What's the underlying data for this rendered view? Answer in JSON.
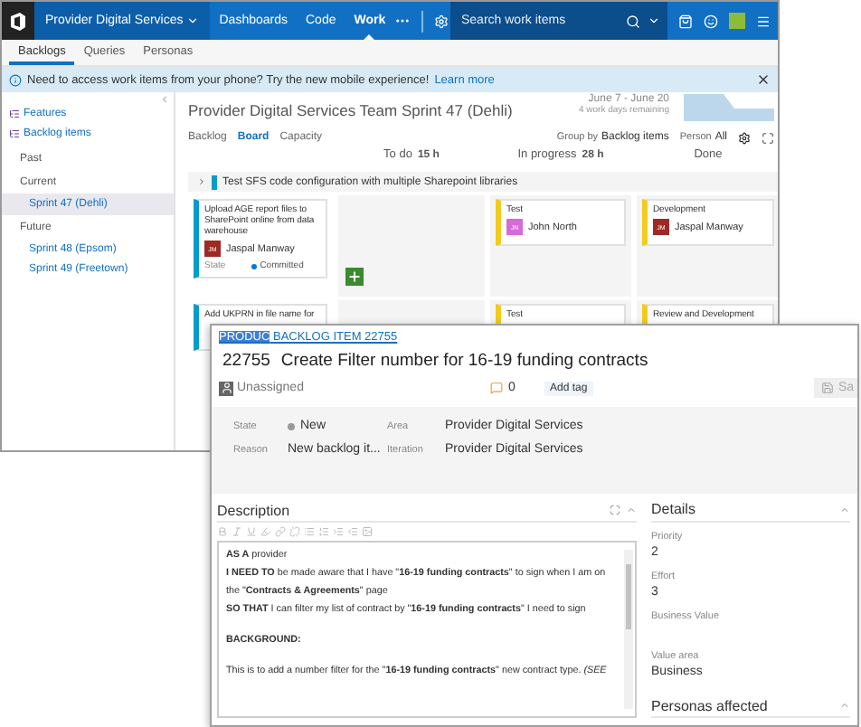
{
  "top_nav": {
    "project": "Provider Digital Services",
    "items": [
      {
        "label": "Dashboards",
        "selected": false
      },
      {
        "label": "Code",
        "selected": false
      },
      {
        "label": "Work",
        "selected": true
      }
    ],
    "search": {
      "placeholder": "Search work items"
    }
  },
  "sub_nav": [
    {
      "label": "Backlogs",
      "selected": true
    },
    {
      "label": "Queries",
      "selected": false
    },
    {
      "label": "Personas",
      "selected": false
    }
  ],
  "banner": {
    "text": "Need to access work items from your phone? Try the new mobile experience!",
    "link": "Learn more"
  },
  "sidebar": [
    {
      "label": "Features",
      "kind": "backlog",
      "selected": false
    },
    {
      "label": "Backlog items",
      "kind": "backlog",
      "selected": false
    },
    {
      "label": "Past",
      "kind": "heading",
      "selected": false
    },
    {
      "label": "Current",
      "kind": "heading",
      "selected": false
    },
    {
      "label": "Sprint 47 (Dehli)",
      "kind": "sprint",
      "selected": true
    },
    {
      "label": "Future",
      "kind": "heading",
      "selected": false
    },
    {
      "label": "Sprint 48 (Epsom)",
      "kind": "sprint",
      "selected": false
    },
    {
      "label": "Sprint 49 (Freetown)",
      "kind": "sprint",
      "selected": false
    }
  ],
  "sprint": {
    "title": "Provider Digital Services Team Sprint 47 (Dehli)",
    "dates": "June 7 - June 20",
    "remaining": "4 work days remaining",
    "views": [
      {
        "label": "Backlog",
        "selected": false
      },
      {
        "label": "Board",
        "selected": true
      },
      {
        "label": "Capacity",
        "selected": false
      }
    ],
    "group_by_label": "Group by",
    "group_by": "Backlog items",
    "person_label": "Person",
    "person": "All"
  },
  "board": {
    "columns": [
      {
        "name": "To do",
        "hours": "15 h"
      },
      {
        "name": "In progress",
        "hours": "28 h"
      },
      {
        "name": "Done"
      }
    ],
    "swimlane": "Test SFS code configuration with multiple Sharepoint libraries",
    "rows": [
      {
        "item": {
          "title": "Upload AGE report files to SharePoint online from data warehouse",
          "initials": "JM",
          "assignee": "Jaspal Manway",
          "state_label": "State",
          "state": "Committed"
        },
        "cells": [
          {
            "can_add": true
          },
          {
            "can_add": false,
            "tasks": [
              {
                "title": "Test",
                "initials": "JN",
                "assignee": "John North",
                "color": "#d66ad8"
              }
            ]
          },
          {
            "can_add": false,
            "tasks": [
              {
                "title": "Development",
                "initials": "JM",
                "assignee": "Jaspal Manway",
                "color": "#9e2a24"
              }
            ]
          }
        ]
      },
      {
        "item": {
          "title": "Add UKPRN in file name for"
        },
        "cells": [
          {},
          {
            "tasks": [
              {
                "title": "Test"
              }
            ]
          },
          {
            "tasks": [
              {
                "title": "Review and Development"
              }
            ]
          }
        ]
      }
    ]
  },
  "work_item": {
    "type_link": {
      "selected_part": "PRODUC",
      "rest": "BACKLOG ITEM 22755"
    },
    "id": "22755",
    "title": "Create Filter number for 16-19 funding contracts",
    "assignee": "Unassigned",
    "comments": "0",
    "add_tag": "Add tag",
    "save": "Sa",
    "fields": [
      {
        "label": "State",
        "value": "New",
        "kind": "state"
      },
      {
        "label": "Area",
        "value": "Provider Digital Services",
        "kind": "text"
      },
      {
        "label": "Reason",
        "value": "New backlog it...",
        "kind": "text"
      },
      {
        "label": "Iteration",
        "value": "Provider Digital Services",
        "kind": "text"
      }
    ],
    "description": {
      "title": "Description",
      "paragraphs": [
        {
          "text": "**AS A** provider",
          "kind": "line"
        },
        {
          "text": "**I NEED TO** be made aware that I have \"**16-19 funding contracts**\" to sign when I am on the \"**Contracts & Agreements**\" page",
          "kind": "line"
        },
        {
          "text": "**SO THAT** I can filter my list of contract by \"**16-19 funding contracts**\" I need to sign",
          "kind": "line"
        },
        {
          "text": "**BACKGROUND:**",
          "kind": "section"
        },
        {
          "text": "This is to add a number filter for the \"**16-19 funding contracts**\" new contract type.  *(SEE*",
          "kind": "section"
        }
      ]
    },
    "details": {
      "title": "Details",
      "fields": [
        {
          "label": "Priority",
          "value": "2"
        },
        {
          "label": "Effort",
          "value": "3"
        },
        {
          "label": "Business Value"
        },
        {
          "label": "Value area",
          "value": "Business"
        }
      ]
    },
    "personas": {
      "title": "Personas affected"
    }
  }
}
